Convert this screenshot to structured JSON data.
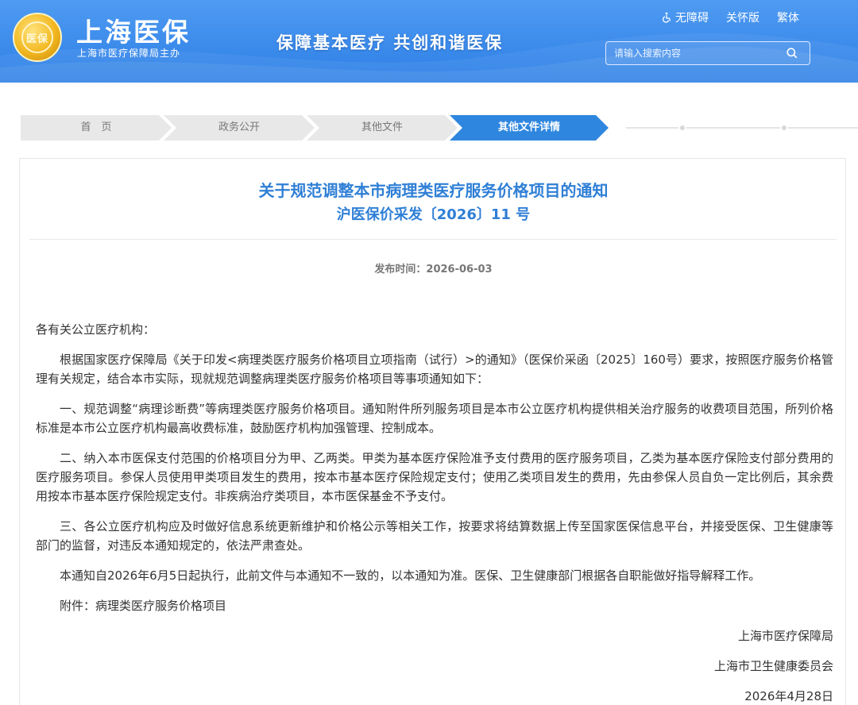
{
  "header": {
    "site_title": "上海医保",
    "site_subtitle": "上海市医疗保障局主办",
    "logo_text": "医保",
    "slogan": "保障基本医疗  共创和谐医保",
    "links": {
      "accessibility": "无障碍",
      "care": "关怀版",
      "traditional": "繁体"
    },
    "search": {
      "placeholder": "请输入搜索内容",
      "value": ""
    }
  },
  "breadcrumb": [
    "首　页",
    "政务公开",
    "其他文件",
    "其他文件详情"
  ],
  "article": {
    "title": "关于规范调整本市病理类医疗服务价格项目的通知",
    "doc_number": "沪医保价采发〔2026〕11 号",
    "publish_label": "发布时间：2026-06-03",
    "salutation": "各有关公立医疗机构：",
    "paragraphs": [
      "根据国家医疗保障局《关于印发<病理类医疗服务价格项目立项指南（试行）>的通知》（医保价采函〔2025〕160号）要求，按照医疗服务价格管理有关规定，结合本市实际，现就规范调整病理类医疗服务价格项目等事项通知如下：",
      "一、规范调整“病理诊断费”等病理类医疗服务价格项目。通知附件所列服务项目是本市公立医疗机构提供相关治疗服务的收费项目范围，所列价格标准是本市公立医疗机构最高收费标准，鼓励医疗机构加强管理、控制成本。",
      "二、纳入本市医保支付范围的价格项目分为甲、乙两类。甲类为基本医疗保险准予支付费用的医疗服务项目，乙类为基本医疗保险支付部分费用的医疗服务项目。参保人员使用甲类项目发生的费用，按本市基本医疗保险规定支付；使用乙类项目发生的费用，先由参保人员自负一定比例后，其余费用按本市基本医疗保险规定支付。非疾病治疗类项目，本市医保基金不予支付。",
      "三、各公立医疗机构应及时做好信息系统更新维护和价格公示等相关工作，按要求将结算数据上传至国家医保信息平台，并接受医保、卫生健康等部门的监督，对违反本通知规定的，依法严肃查处。",
      "本通知自2026年6月5日起执行，此前文件与本通知不一致的，以本通知为准。医保、卫生健康部门根据各自职能做好指导解释工作。",
      "附件：病理类医疗服务价格项目"
    ],
    "signatures": [
      "上海市医疗保障局",
      "上海市卫生健康委员会",
      "2026年4月28日"
    ]
  },
  "colors": {
    "header_blue": "#2d7fe6",
    "title_blue": "#2f7fd6",
    "crumb_active": "#2e86de"
  }
}
